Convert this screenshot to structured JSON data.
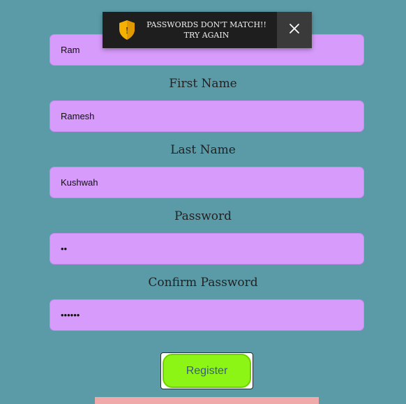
{
  "form": {
    "username_value": "Ram",
    "first_name_label": "First Name",
    "first_name_value": "Ramesh",
    "last_name_label": "Last Name",
    "last_name_value": "Kushwah",
    "password_label": "Password",
    "password_value": "••",
    "confirm_password_label": "Confirm Password",
    "confirm_password_value": "••••••",
    "register_label": "Register"
  },
  "toast": {
    "line1": "PASSWORDS DON'T MATCH!!",
    "line2": "TRY AGAIN",
    "icon": "shield-warning-icon",
    "icon_badge": "!",
    "close_icon": "close-icon"
  },
  "colors": {
    "background": "#5b9ba8",
    "field": "#d69bfb",
    "button": "#8df515",
    "toast": "#1e1e1e",
    "toast_shield": "#f5b000"
  }
}
